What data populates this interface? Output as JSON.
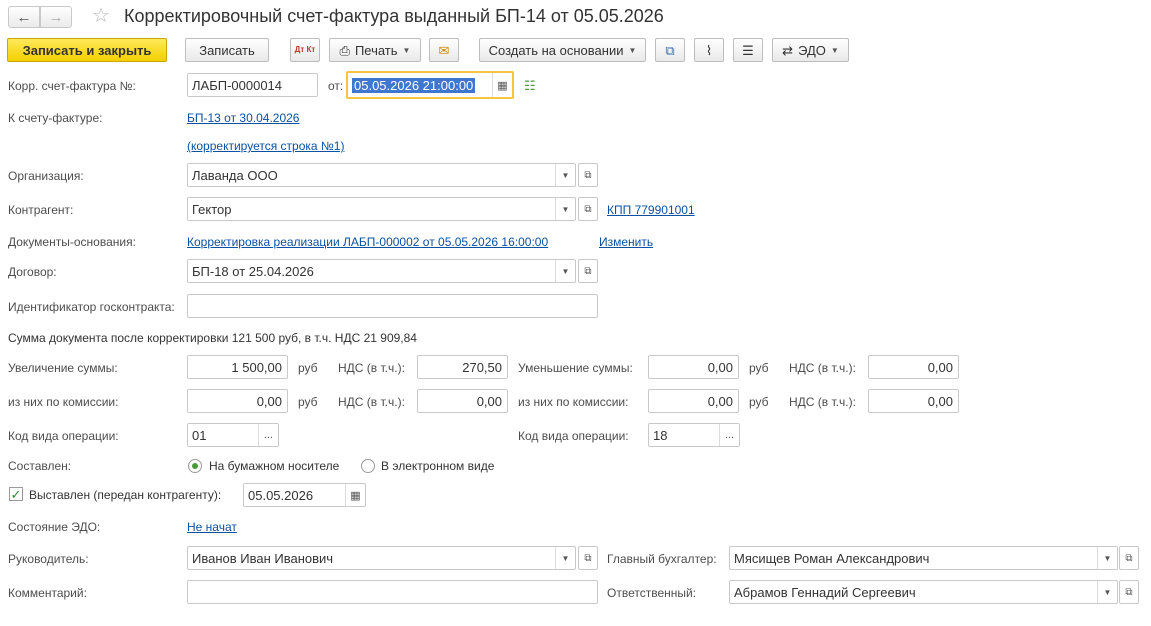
{
  "header": {
    "title": "Корректировочный счет-фактура выданный БП-14 от 05.05.2026",
    "back_icon": "←",
    "forward_icon": "→",
    "star_icon": "☆"
  },
  "toolbar": {
    "save_close": "Записать и закрыть",
    "save": "Записать",
    "dt_kt": "Дт Кт",
    "print": "Печать",
    "create_based": "Создать на основании",
    "edo": "ЭДО"
  },
  "form": {
    "corr_invoice_label": "Корр. счет-фактура №:",
    "corr_invoice_number": "ЛАБП-0000014",
    "from_label": "от:",
    "from_date": "05.05.2026 21:00:00",
    "to_invoice_label": "К счету-фактуре:",
    "to_invoice_link": "БП-13 от 30.04.2026",
    "corrected_line_link": "(корректируется строка №1)",
    "organization_label": "Организация:",
    "organization_value": "Лаванда ООО",
    "counterparty_label": "Контрагент:",
    "counterparty_value": "Гектор",
    "kpp_link": "КПП 779901001",
    "base_docs_label": "Документы-основания:",
    "base_docs_link": "Корректировка реализации ЛАБП-000002 от 05.05.2026 16:00:00",
    "change_link": "Изменить",
    "contract_label": "Договор:",
    "contract_value": "БП-18 от 25.04.2026",
    "gov_contract_label": "Идентификатор госконтракта:",
    "gov_contract_value": "",
    "sum_after_text": "Сумма документа после корректировки 121 500 руб, в т.ч. НДС 21 909,84",
    "increase_label": "Увеличение суммы:",
    "increase_value": "1 500,00",
    "currency": "руб",
    "vat_label": "НДС (в т.ч.):",
    "increase_vat": "270,50",
    "decrease_label": "Уменьшение суммы:",
    "decrease_value": "0,00",
    "decrease_vat": "0,00",
    "commission_label": "из них по комиссии:",
    "commission_inc_value": "0,00",
    "commission_inc_vat": "0,00",
    "commission_dec_value": "0,00",
    "commission_dec_vat": "0,00",
    "op_code_label": "Код вида операции:",
    "op_code_left": "01",
    "op_code_right": "18",
    "composed_label": "Составлен:",
    "paper_label": "На бумажном носителе",
    "electronic_label": "В электронном виде",
    "issued_label": "Выставлен (передан контрагенту):",
    "issued_date": "05.05.2026",
    "edo_state_label": "Состояние ЭДО:",
    "edo_state_link": "Не начат",
    "head_label": "Руководитель:",
    "head_value": "Иванов Иван Иванович",
    "chief_acc_label": "Главный бухгалтер:",
    "chief_acc_value": "Мясищев Роман Александрович",
    "comment_label": "Комментарий:",
    "comment_value": "",
    "responsible_label": "Ответственный:",
    "responsible_value": "Абрамов Геннадий Сергеевич"
  },
  "colors": {
    "primary_button": "#f4d000",
    "link": "#0b51a1",
    "focus_border": "#f7c340",
    "selection": "#3f76cf"
  }
}
